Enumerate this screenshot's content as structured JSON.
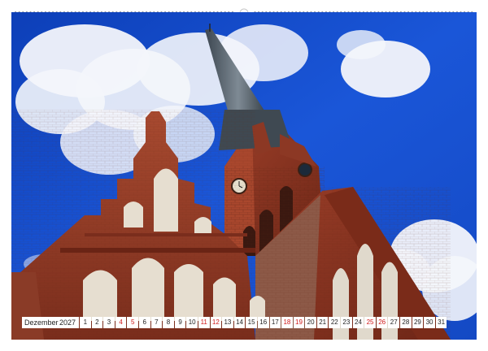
{
  "calendar": {
    "month_label": "Dezember",
    "year_label": "2027",
    "days": [
      {
        "n": "1",
        "red": false
      },
      {
        "n": "2",
        "red": false
      },
      {
        "n": "3",
        "red": false
      },
      {
        "n": "4",
        "red": true
      },
      {
        "n": "5",
        "red": true
      },
      {
        "n": "6",
        "red": false
      },
      {
        "n": "7",
        "red": false
      },
      {
        "n": "8",
        "red": false
      },
      {
        "n": "9",
        "red": false
      },
      {
        "n": "10",
        "red": false
      },
      {
        "n": "11",
        "red": true
      },
      {
        "n": "12",
        "red": true
      },
      {
        "n": "13",
        "red": false
      },
      {
        "n": "14",
        "red": false
      },
      {
        "n": "15",
        "red": false
      },
      {
        "n": "16",
        "red": false
      },
      {
        "n": "17",
        "red": false
      },
      {
        "n": "18",
        "red": true
      },
      {
        "n": "19",
        "red": true
      },
      {
        "n": "20",
        "red": false
      },
      {
        "n": "21",
        "red": false
      },
      {
        "n": "22",
        "red": false
      },
      {
        "n": "23",
        "red": false
      },
      {
        "n": "24",
        "red": false
      },
      {
        "n": "25",
        "red": true
      },
      {
        "n": "26",
        "red": true
      },
      {
        "n": "27",
        "red": false
      },
      {
        "n": "28",
        "red": false
      },
      {
        "n": "29",
        "red": false
      },
      {
        "n": "30",
        "red": false
      },
      {
        "n": "31",
        "red": false
      }
    ]
  },
  "colors": {
    "sky": "#1a4fd0",
    "brick": "#9a3a24",
    "weekend": "#d01919"
  }
}
